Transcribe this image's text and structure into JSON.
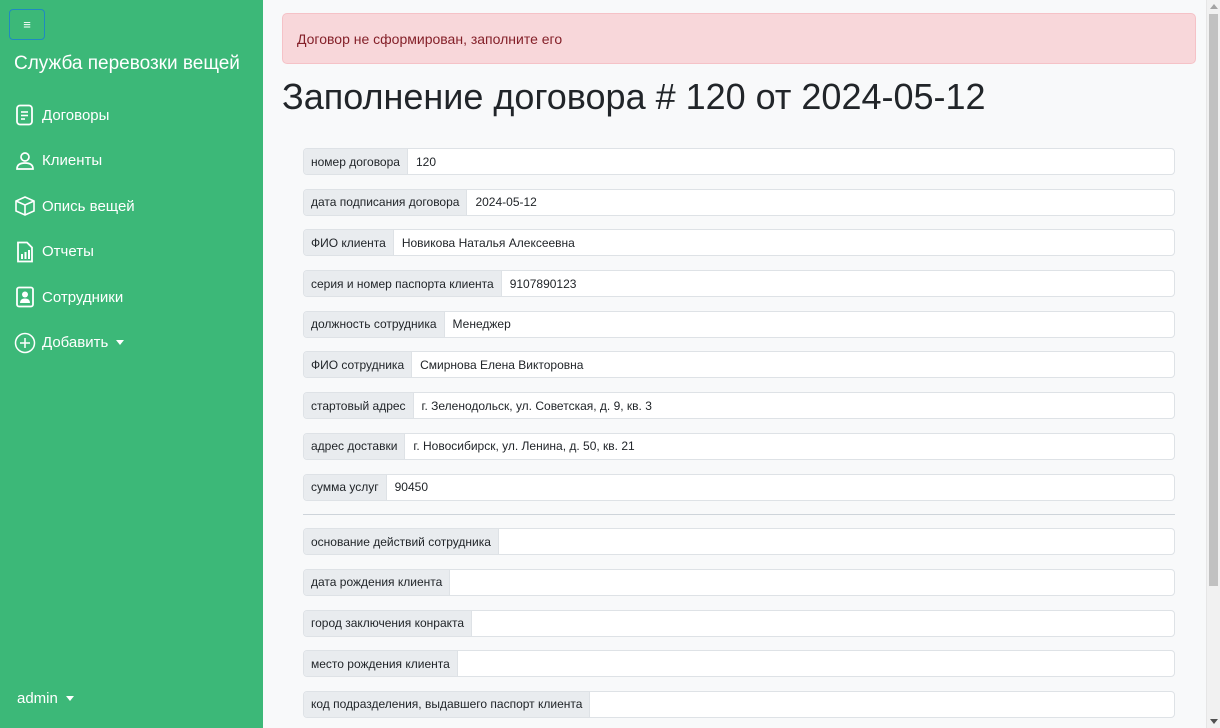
{
  "sidebar": {
    "toggle_icon": "hamburger-icon",
    "toggle_glyph": "≡",
    "brand": "Служба перевозки вещей",
    "items": [
      {
        "label": "Договоры",
        "icon": "document-icon"
      },
      {
        "label": "Клиенты",
        "icon": "person-icon"
      },
      {
        "label": "Опись вещей",
        "icon": "box-icon"
      },
      {
        "label": "Отчеты",
        "icon": "report-icon"
      },
      {
        "label": "Сотрудники",
        "icon": "employee-badge-icon"
      },
      {
        "label": "Добавить",
        "icon": "plus-circle-icon",
        "dropdown": true
      }
    ],
    "user": "admin",
    "bg_color": "#3cb878"
  },
  "alert": {
    "text": "Договор не сформирован, заполните его",
    "color": "#f8d7da"
  },
  "page_title": "Заполнение договора # 120 от 2024-05-12",
  "fields_filled": [
    {
      "label": "номер договора",
      "value": "120"
    },
    {
      "label": "дата подписания договора",
      "value": "2024-05-12"
    },
    {
      "label": "ФИО клиента",
      "value": "Новикова Наталья Алексеевна"
    },
    {
      "label": "серия и номер паспорта клиента",
      "value": "9107890123"
    },
    {
      "label": "должность сотрудника",
      "value": "Менеджер"
    },
    {
      "label": "ФИО сотрудника",
      "value": "Смирнова Елена Викторовна"
    },
    {
      "label": "стартовый адрес",
      "value": "г. Зеленодольск, ул. Советская, д. 9, кв. 3"
    },
    {
      "label": "адрес доставки",
      "value": "г. Новосибирск, ул. Ленина, д. 50, кв. 21"
    },
    {
      "label": "сумма услуг",
      "value": "90450"
    }
  ],
  "fields_empty": [
    {
      "label": "основание действий сотрудника",
      "value": ""
    },
    {
      "label": "дата рождения клиента",
      "value": ""
    },
    {
      "label": "город заключения конракта",
      "value": ""
    },
    {
      "label": "место рождения клиента",
      "value": ""
    },
    {
      "label": "код подразделения, выдавшего паспорт клиента",
      "value": ""
    }
  ]
}
